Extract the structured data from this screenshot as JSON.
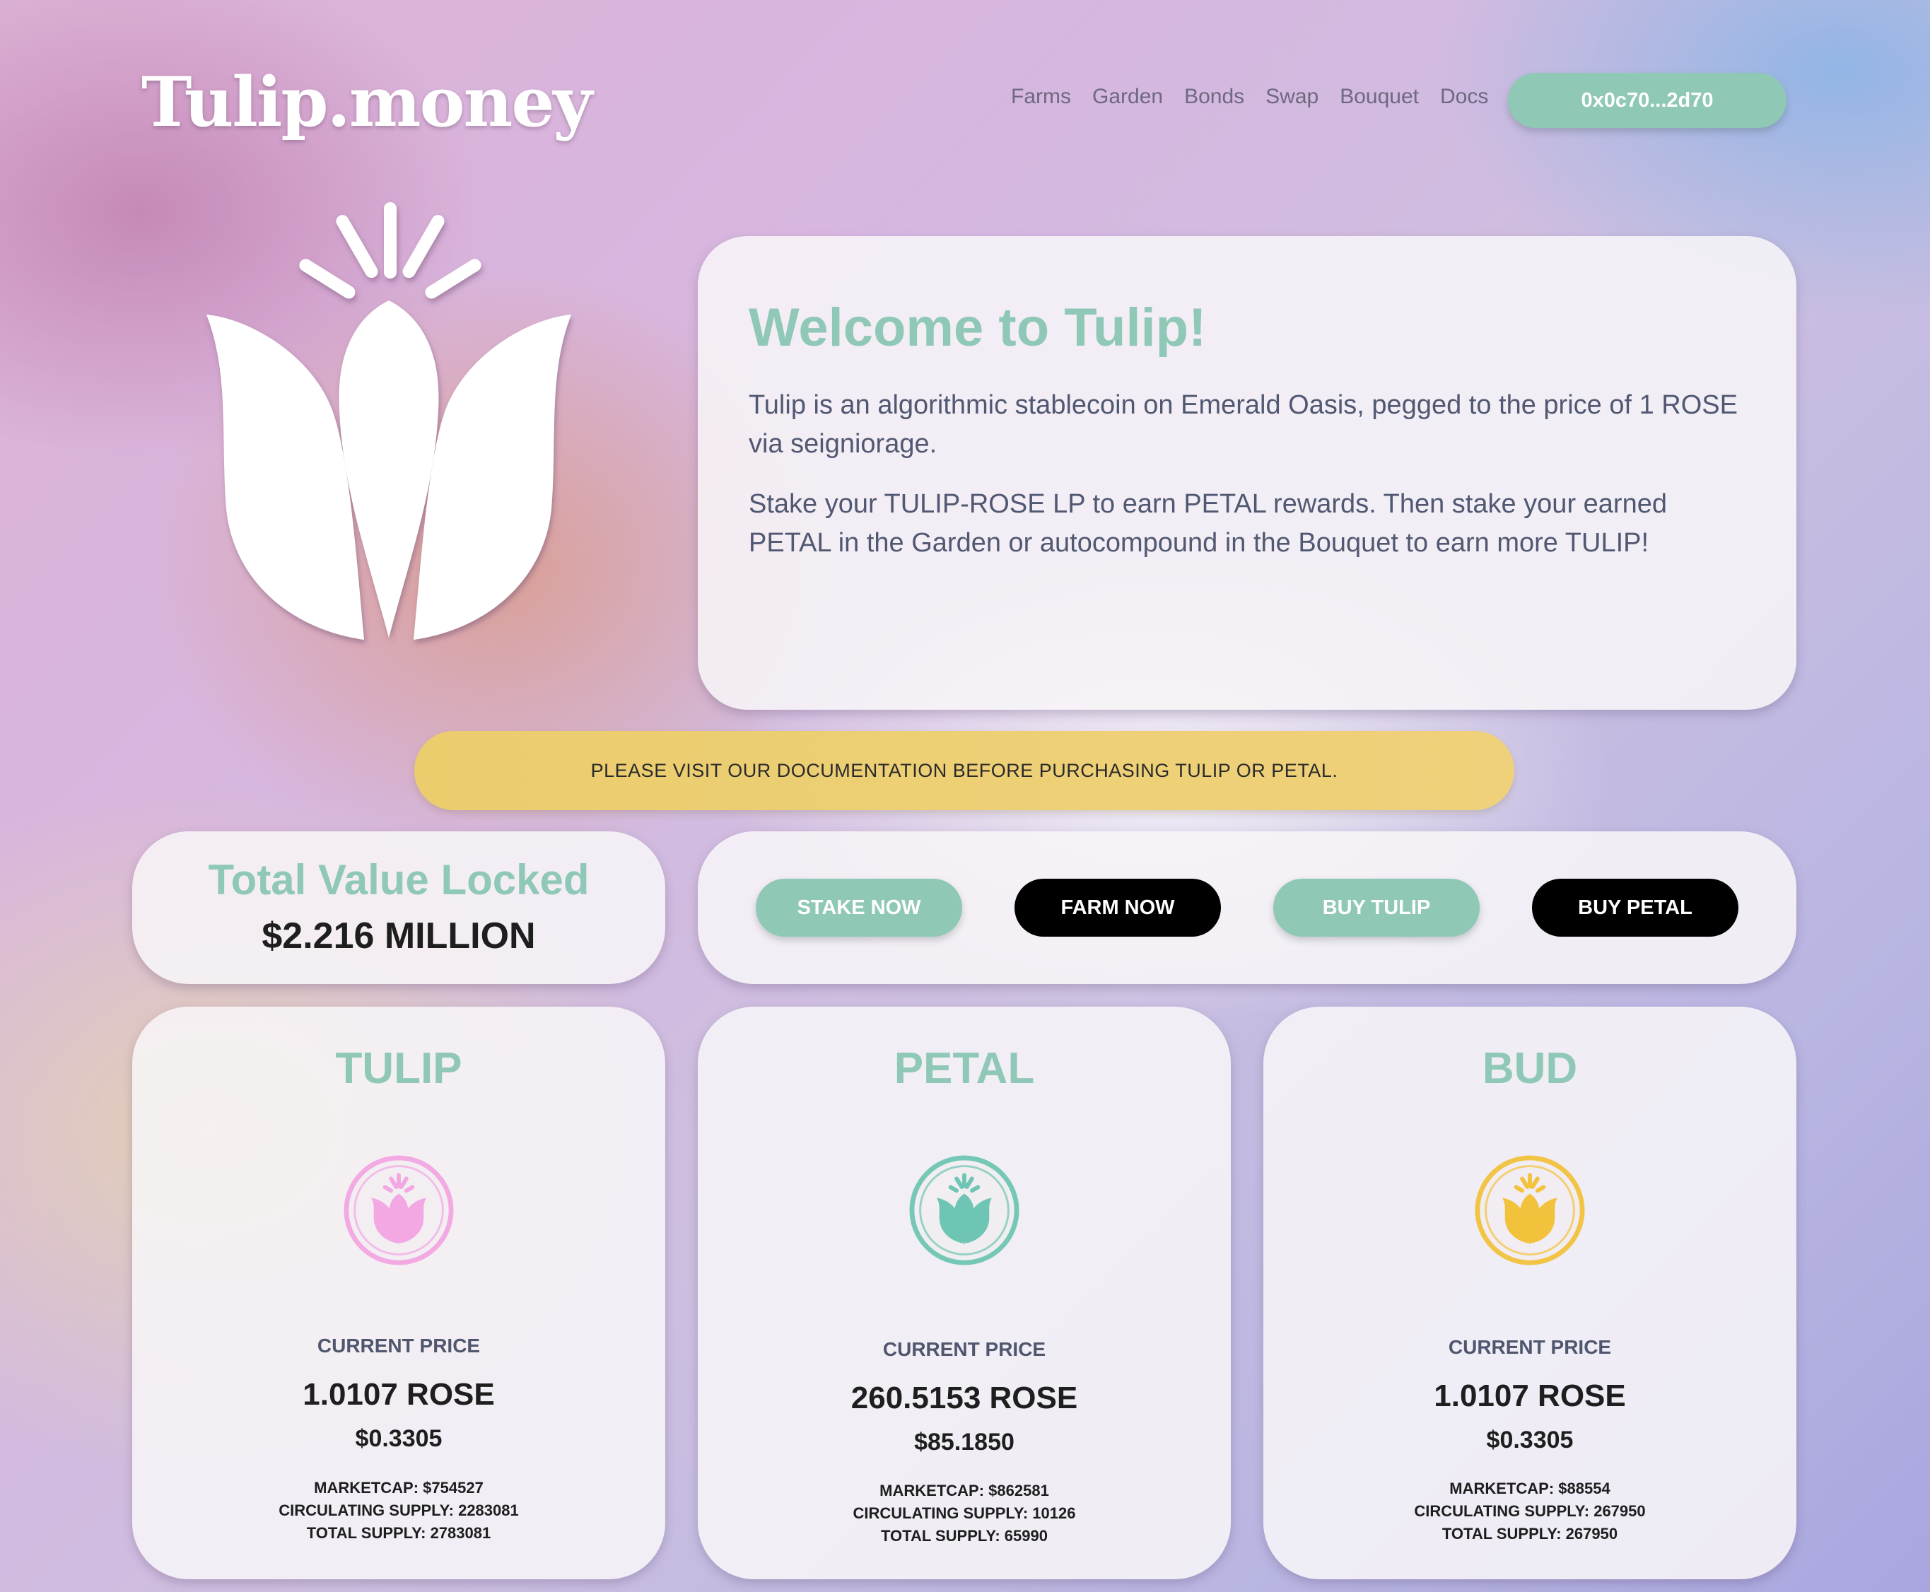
{
  "header": {
    "logo": "Tulip.money",
    "nav": [
      "Farms",
      "Garden",
      "Bonds",
      "Swap",
      "Bouquet",
      "Docs"
    ],
    "wallet": "0x0c70...2d70"
  },
  "welcome": {
    "title": "Welcome to Tulip!",
    "p1": "Tulip is an algorithmic stablecoin on Emerald Oasis, pegged to the price of 1 ROSE via seigniorage.",
    "p2": "Stake your TULIP-ROSE LP to earn PETAL rewards. Then stake your earned PETAL in the Garden or autocompound in the Bouquet to earn more TULIP!"
  },
  "notice": "PLEASE VISIT OUR DOCUMENTATION BEFORE PURCHASING TULIP OR PETAL.",
  "tvl": {
    "label": "Total Value Locked",
    "value": "$2.216 MILLION"
  },
  "actions": [
    "STAKE NOW",
    "FARM NOW",
    "BUY TULIP",
    "BUY PETAL"
  ],
  "tokens": [
    {
      "name": "TULIP",
      "icon_color": "#f3a7e3",
      "price_label": "CURRENT PRICE",
      "price_rose": "1.0107 ROSE",
      "price_usd": "$0.3305",
      "marketcap": "MARKETCAP: $754527",
      "circulating": "CIRCULATING SUPPLY: 2283081",
      "total": "TOTAL SUPPLY: 2783081"
    },
    {
      "name": "PETAL",
      "icon_color": "#6fc5b3",
      "price_label": "CURRENT PRICE",
      "price_rose": "260.5153 ROSE",
      "price_usd": "$85.1850",
      "marketcap": "MARKETCAP: $862581",
      "circulating": "CIRCULATING SUPPLY: 10126",
      "total": "TOTAL SUPPLY: 65990"
    },
    {
      "name": "BUD",
      "icon_color": "#f3c23c",
      "price_label": "CURRENT PRICE",
      "price_rose": "1.0107 ROSE",
      "price_usd": "$0.3305",
      "marketcap": "MARKETCAP: $88554",
      "circulating": "CIRCULATING SUPPLY: 267950",
      "total": "TOTAL SUPPLY: 267950"
    }
  ]
}
